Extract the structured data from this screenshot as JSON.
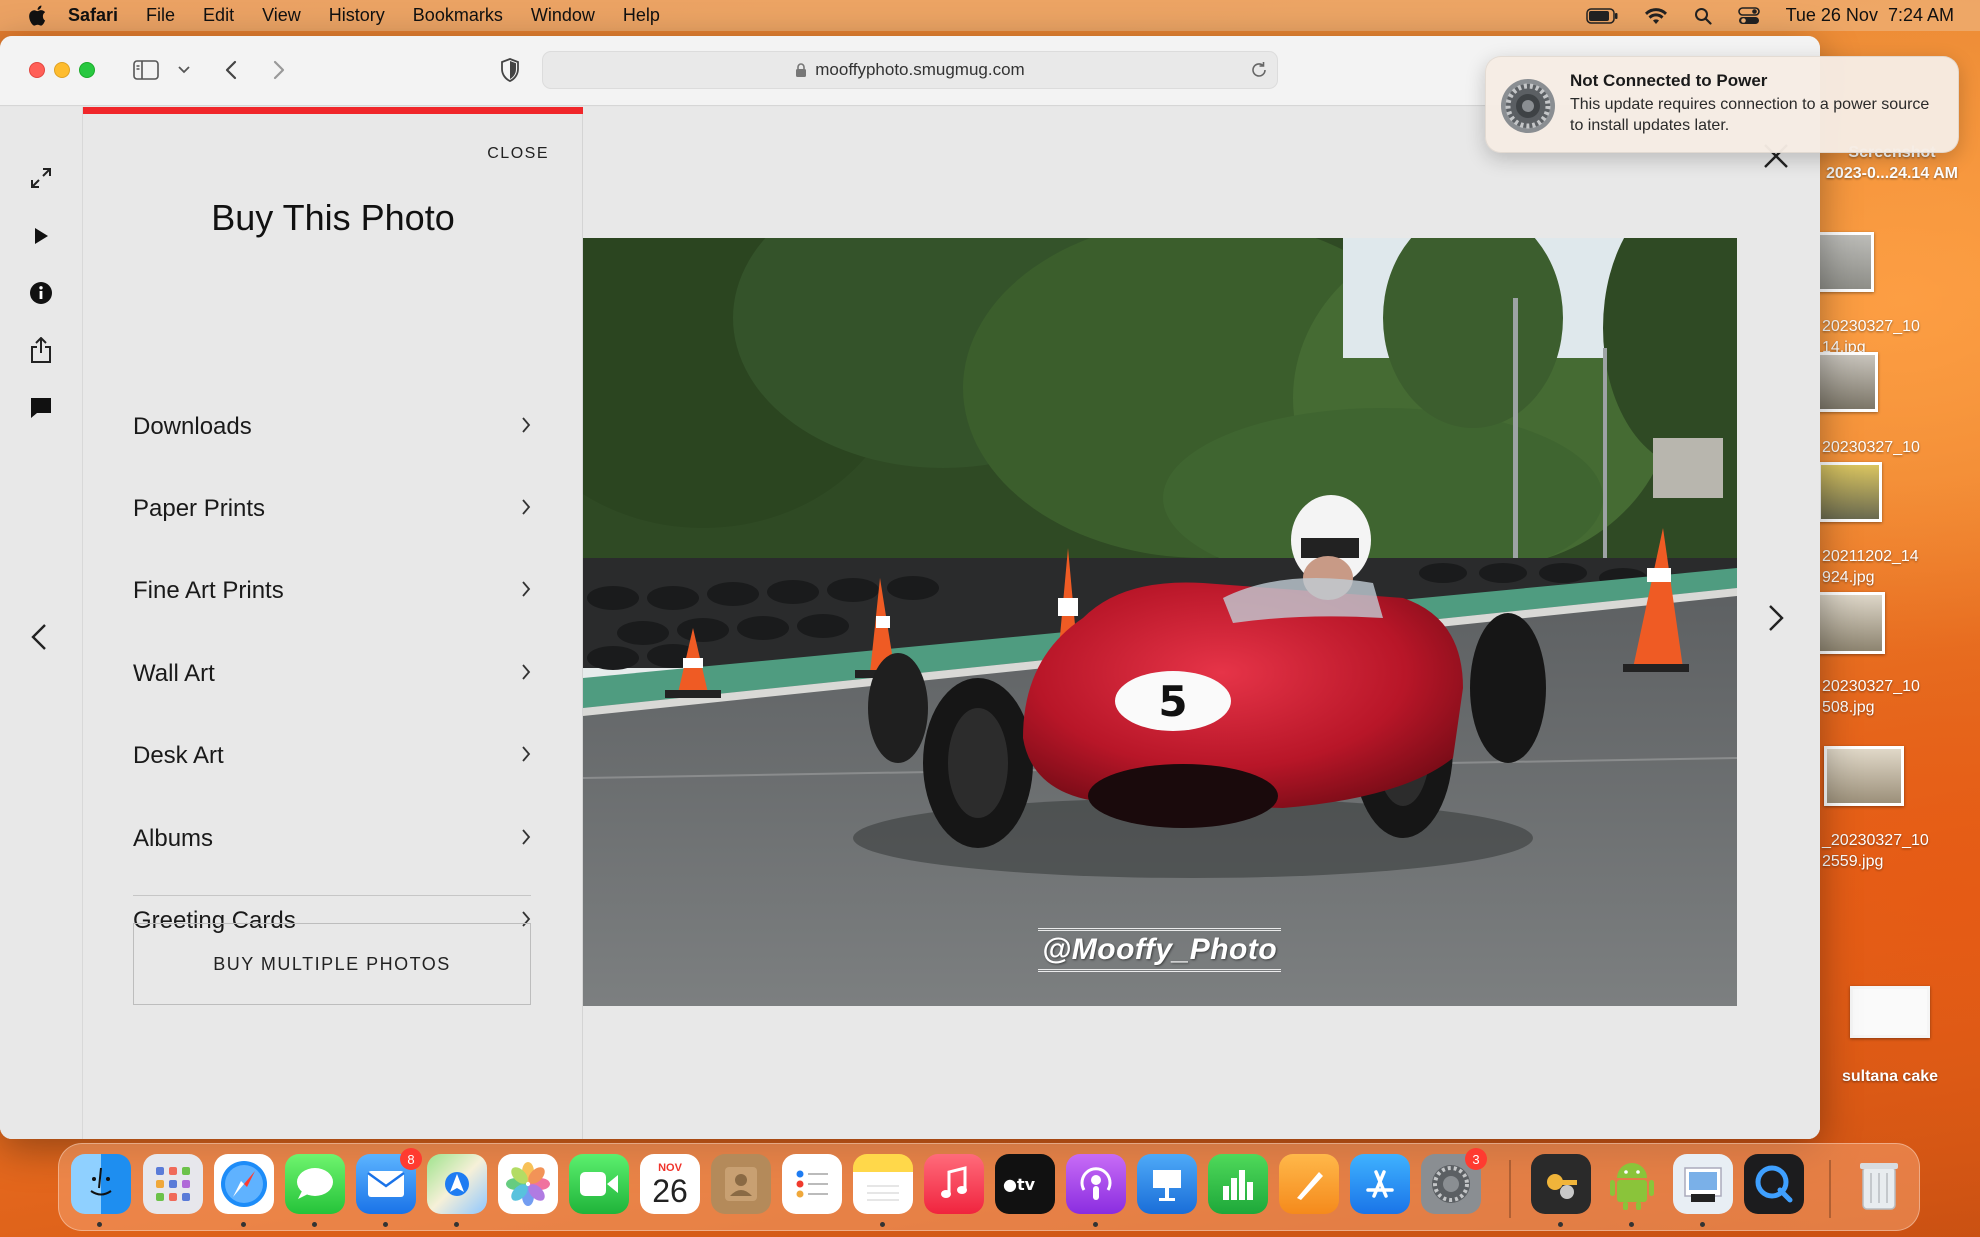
{
  "menubar": {
    "app_name": "Safari",
    "items": [
      "File",
      "Edit",
      "View",
      "History",
      "Bookmarks",
      "Window",
      "Help"
    ],
    "datetime": "Tue 26 Nov  7:24 AM"
  },
  "browser": {
    "url": "mooffyphoto.smugmug.com"
  },
  "buy_panel": {
    "close_label": "CLOSE",
    "title": "Buy This Photo",
    "options": [
      "Downloads",
      "Paper Prints",
      "Fine Art Prints",
      "Wall Art",
      "Desk Art",
      "Albums",
      "Greeting Cards"
    ],
    "buy_multiple_label": "BUY MULTIPLE PHOTOS"
  },
  "photo": {
    "watermark": "@Mooffy_Photo",
    "car_number": "5"
  },
  "notification": {
    "title": "Not Connected to Power",
    "body": "This update requires connection to a power source to install updates later."
  },
  "desktop": {
    "items": [
      {
        "label": "Screenshot\n2023-0...24.14 AM"
      },
      {
        "label": "20230327_10\n14.jpg"
      },
      {
        "label": "20230327_10"
      },
      {
        "label": "20211202_14\n924.jpg"
      },
      {
        "label": "20230327_10\n508.jpg"
      },
      {
        "label": "_20230327_10\n2559.jpg"
      },
      {
        "label": "sultana cake"
      }
    ]
  },
  "dock": {
    "mail_badge": "8",
    "settings_badge": "3",
    "calendar_month": "NOV",
    "calendar_day": "26"
  }
}
